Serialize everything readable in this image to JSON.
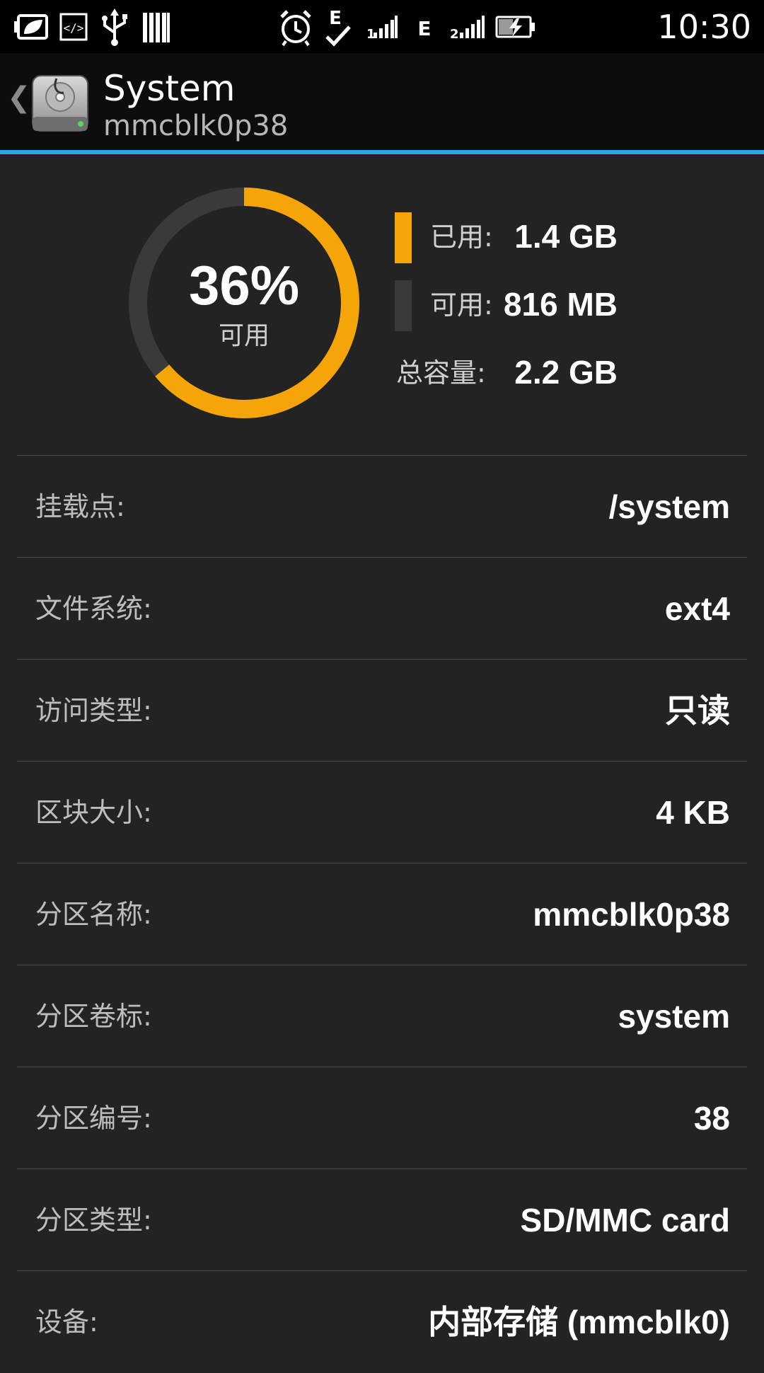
{
  "status_bar": {
    "time": "10:30",
    "network_type_1": "E",
    "network_type_2": "E",
    "sim_1_label": "1",
    "sim_2_label": "2",
    "icons": [
      "eco-battery-icon",
      "code-icon",
      "usb-icon",
      "barcode-icon",
      "alarm-icon",
      "edge-check-icon",
      "signal-1-icon",
      "edge-icon",
      "signal-2-icon",
      "battery-charging-icon"
    ]
  },
  "action_bar": {
    "back_glyph": "❮",
    "title": "System",
    "subtitle": "mmcblk0p38",
    "accent_color": "#2aa8e0"
  },
  "summary": {
    "percent_text": "36%",
    "percent_label": "可用",
    "free_fraction": 0.36,
    "used_color": "#f5a507",
    "free_color": "#3a3a3a",
    "legend": [
      {
        "label": "已用:",
        "value": "1.4 GB",
        "color": "#f5a507"
      },
      {
        "label": "可用:",
        "value": "816 MB",
        "color": "#3a3a3a"
      },
      {
        "label": "总容量:",
        "value": "2.2 GB"
      }
    ]
  },
  "rows": [
    {
      "label": "挂载点:",
      "value": "/system"
    },
    {
      "label": "文件系统:",
      "value": "ext4"
    },
    {
      "label": "访问类型:",
      "value": "只读"
    },
    {
      "label": "区块大小:",
      "value": "4 KB"
    },
    {
      "label": "分区名称:",
      "value": "mmcblk0p38"
    },
    {
      "label": "分区卷标:",
      "value": "system"
    },
    {
      "label": "分区编号:",
      "value": "38"
    },
    {
      "label": "分区类型:",
      "value": "SD/MMC card"
    },
    {
      "label": "设备:",
      "value": "内部存储 (mmcblk0)"
    }
  ]
}
